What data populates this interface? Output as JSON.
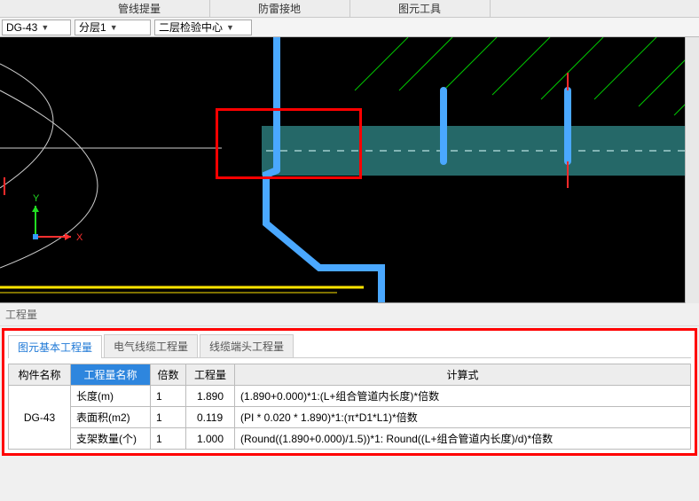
{
  "topTabs": [
    "",
    "管线提量",
    "防雷接地",
    "图元工具",
    ""
  ],
  "toolbar": {
    "comp": "DG-43",
    "layer": "分层1",
    "view": "二层检验中心"
  },
  "sectionTitle": "工程量",
  "innerTabs": [
    {
      "label": "图元基本工程量",
      "active": true
    },
    {
      "label": "电气线缆工程量",
      "active": false
    },
    {
      "label": "线缆端头工程量",
      "active": false
    }
  ],
  "table": {
    "headers": {
      "component": "构件名称",
      "qtyName": "工程量名称",
      "multiplier": "倍数",
      "qty": "工程量",
      "formula": "计算式"
    },
    "componentName": "DG-43",
    "rows": [
      {
        "name": "长度(m)",
        "mult": "1",
        "qty": "1.890",
        "formula": "(1.890+0.000)*1:(L+组合管道内长度)*倍数"
      },
      {
        "name": "表面积(m2)",
        "mult": "1",
        "qty": "0.119",
        "formula": "(PI * 0.020 * 1.890)*1:(π*D1*L1)*倍数"
      },
      {
        "name": "支架数量(个)",
        "mult": "1",
        "qty": "1.000",
        "formula": "(Round((1.890+0.000)/1.5))*1: Round((L+组合管道内长度)/d)*倍数"
      }
    ]
  }
}
